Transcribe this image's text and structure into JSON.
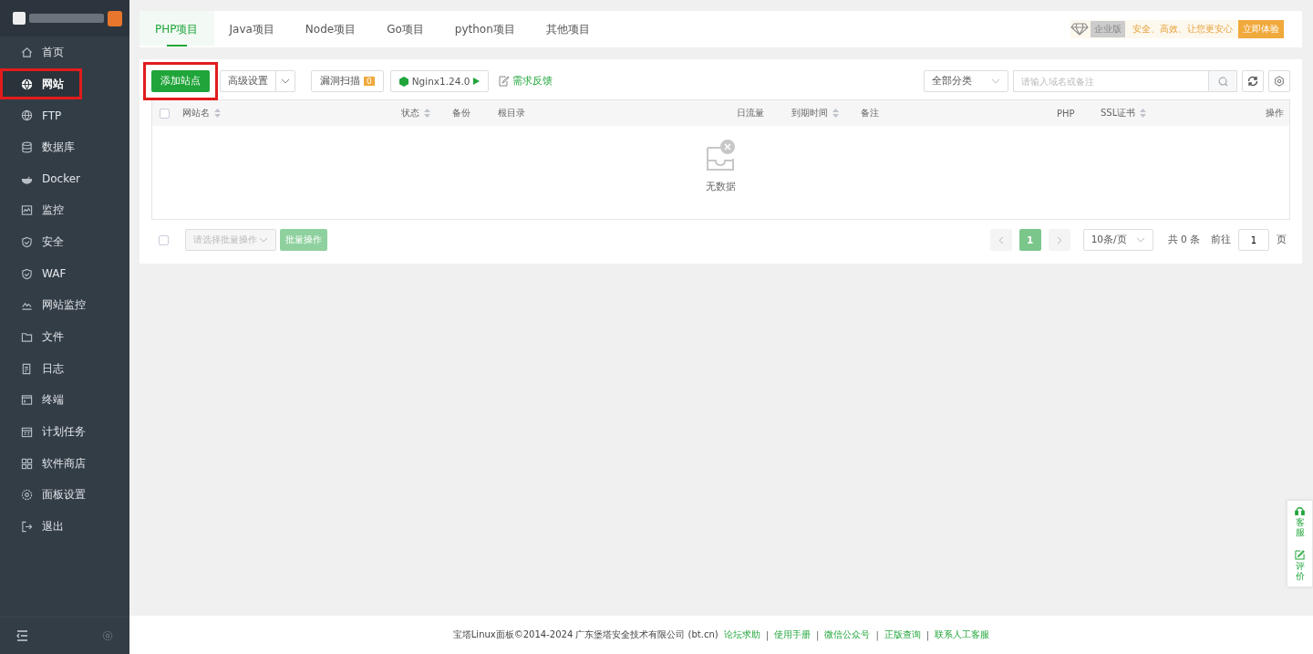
{
  "sidebar": {
    "items": [
      {
        "label": "首页",
        "selected": false,
        "highlighted": false
      },
      {
        "label": "网站",
        "selected": true,
        "highlighted": true
      },
      {
        "label": "FTP",
        "selected": false,
        "highlighted": false
      },
      {
        "label": "数据库",
        "selected": false,
        "highlighted": false
      },
      {
        "label": "Docker",
        "selected": false,
        "highlighted": false
      },
      {
        "label": "监控",
        "selected": false,
        "highlighted": false
      },
      {
        "label": "安全",
        "selected": false,
        "highlighted": false
      },
      {
        "label": "WAF",
        "selected": false,
        "highlighted": false
      },
      {
        "label": "网站监控",
        "selected": false,
        "highlighted": false
      },
      {
        "label": "文件",
        "selected": false,
        "highlighted": false
      },
      {
        "label": "日志",
        "selected": false,
        "highlighted": false
      },
      {
        "label": "终端",
        "selected": false,
        "highlighted": false
      },
      {
        "label": "计划任务",
        "selected": false,
        "highlighted": false
      },
      {
        "label": "软件商店",
        "selected": false,
        "highlighted": false
      },
      {
        "label": "面板设置",
        "selected": false,
        "highlighted": false
      },
      {
        "label": "退出",
        "selected": false,
        "highlighted": false
      }
    ]
  },
  "tabs": [
    {
      "label": "PHP项目",
      "selected": true
    },
    {
      "label": "Java项目",
      "selected": false
    },
    {
      "label": "Node项目",
      "selected": false
    },
    {
      "label": "Go项目",
      "selected": false
    },
    {
      "label": "python项目",
      "selected": false
    },
    {
      "label": "其他项目",
      "selected": false
    }
  ],
  "promo": {
    "badge": "企业版",
    "text": "安全、高效、让您更安心",
    "button": "立即体验"
  },
  "toolbar": {
    "add_button": "添加站点",
    "add_highlighted": true,
    "advanced": "高级设置",
    "scan": "漏洞扫描",
    "scan_count": "0",
    "nginx": "Nginx1.24.0",
    "feedback": "需求反馈",
    "category": "全部分类",
    "search_placeholder": "请输入域名或备注"
  },
  "table": {
    "columns": [
      {
        "label": "网站名",
        "sortable": true
      },
      {
        "label": "状态",
        "sortable": true
      },
      {
        "label": "备份",
        "sortable": false
      },
      {
        "label": "根目录",
        "sortable": false
      },
      {
        "label": "日流量",
        "sortable": false
      },
      {
        "label": "到期时间",
        "sortable": true
      },
      {
        "label": "备注",
        "sortable": false
      },
      {
        "label": "PHP",
        "sortable": false
      },
      {
        "label": "SSL证书",
        "sortable": true
      },
      {
        "label": "操作",
        "sortable": false
      }
    ],
    "select_all_checked": false,
    "empty_text": "无数据"
  },
  "batch": {
    "checked": false,
    "placeholder": "请选择批量操作",
    "button": "批量操作"
  },
  "pagination": {
    "pages": [
      {
        "label": "1",
        "selected": true
      }
    ],
    "page_size": "10条/页",
    "total": "共 0 条",
    "goto": "前往",
    "goto_value": "1",
    "page_unit": "页"
  },
  "footer": {
    "copyright": "宝塔Linux面板©2014-2024 广东堡塔安全技术有限公司 (bt.cn)",
    "separator": "|",
    "links": [
      "论坛求助",
      "使用手册",
      "微信公众号",
      "正版查询",
      "联系人工客服"
    ]
  },
  "float_widget": [
    {
      "label": "客服"
    },
    {
      "label": "评价"
    }
  ]
}
